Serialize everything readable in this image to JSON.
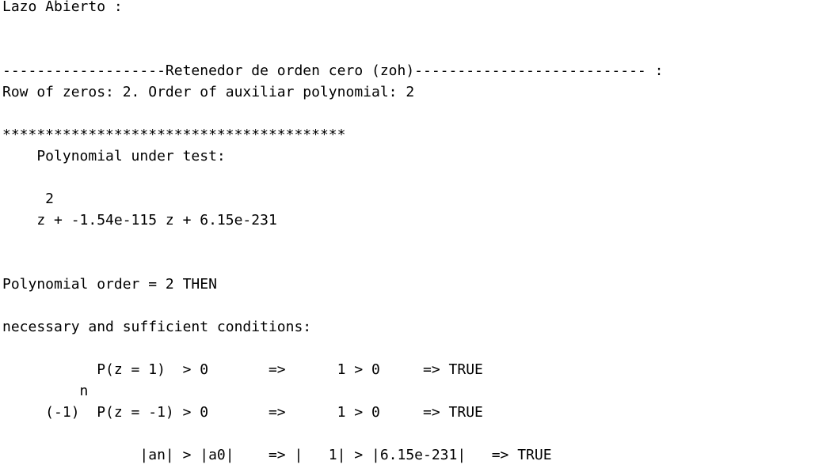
{
  "console": {
    "lines": [
      "Lazo Abierto :",
      "",
      "",
      "-------------------Retenedor de orden cero (zoh)--------------------------- :",
      "Row of zeros: 2. Order of auxiliar polynomial: 2",
      "",
      "****************************************",
      "    Polynomial under test:",
      "",
      "     2",
      "    z + -1.54e-115 z + 6.15e-231",
      "",
      "",
      "Polynomial order = 2 THEN",
      "",
      "necessary and sufficient conditions:",
      "",
      "           P(z = 1)  > 0       =>      1 > 0     => TRUE",
      "         n",
      "     (-1)  P(z = -1) > 0       =>      1 > 0     => TRUE",
      "",
      "                |an| > |a0|    => |   1| > |6.15e-231|   => TRUE"
    ]
  }
}
